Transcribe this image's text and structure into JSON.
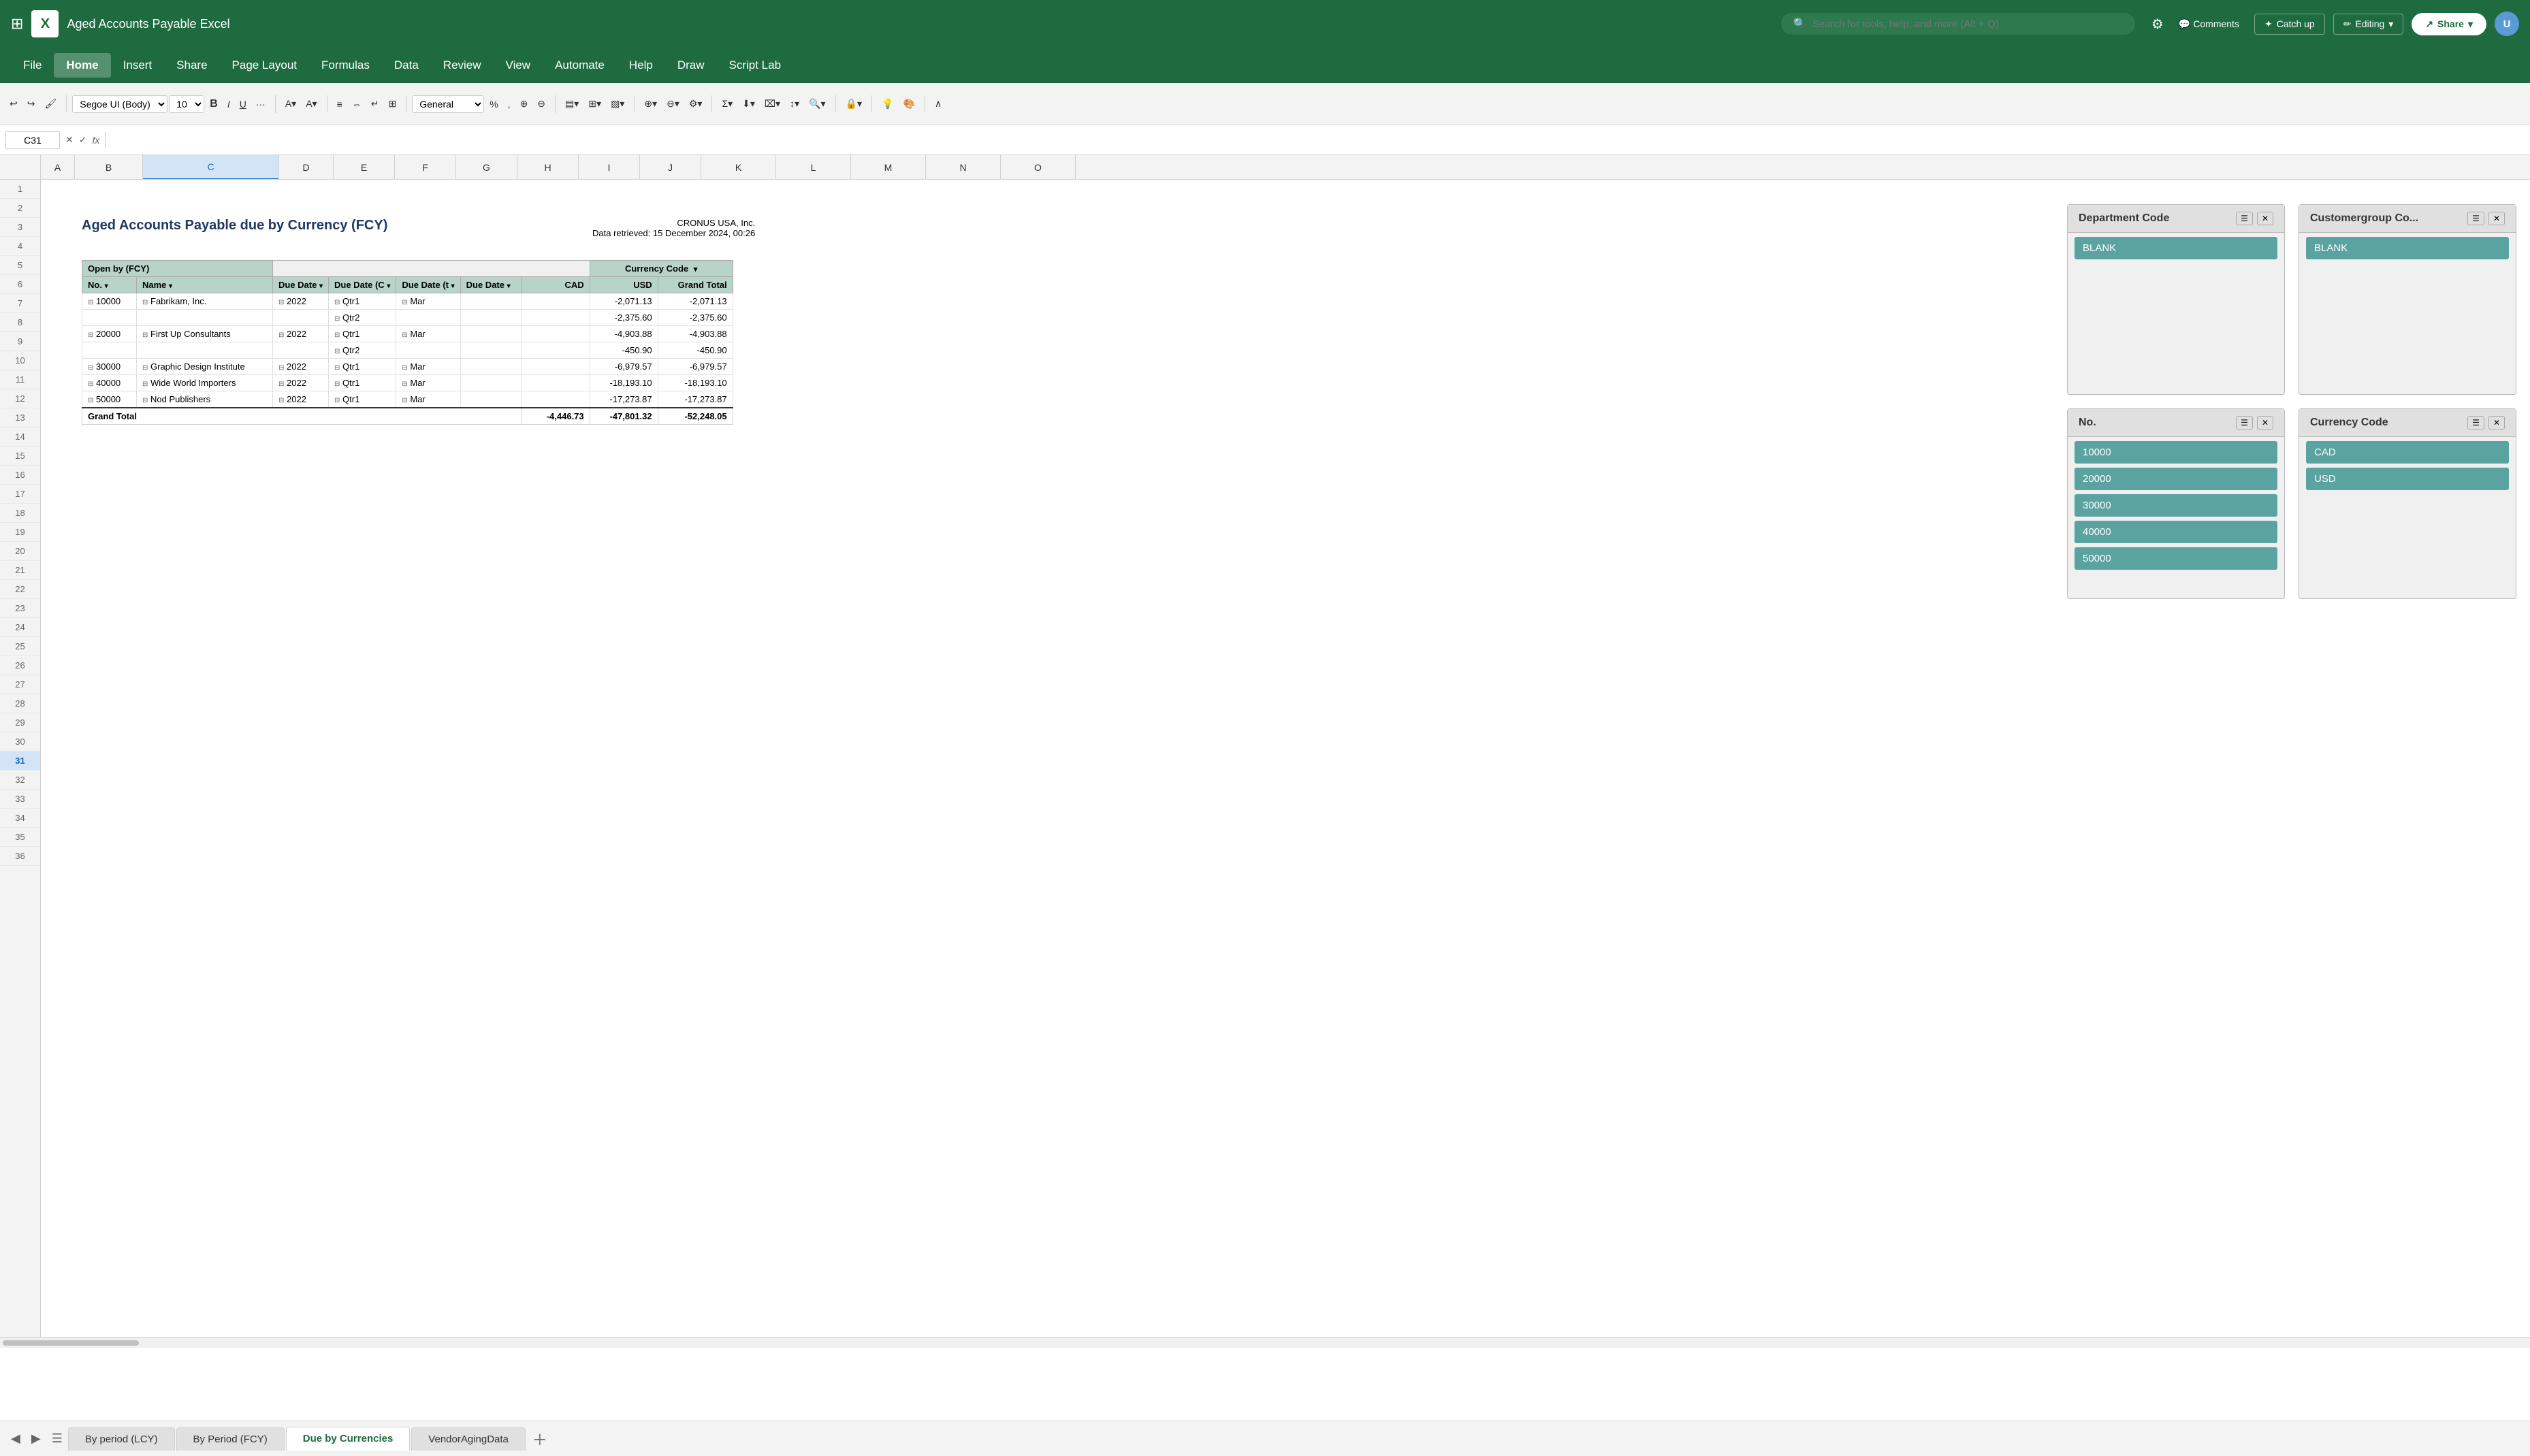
{
  "titlebar": {
    "app_name": "Aged Accounts Payable Excel",
    "search_placeholder": "Search for tools, help, and more (Alt + Q)",
    "catch_up_label": "Catch up",
    "editing_label": "Editing",
    "share_label": "Share"
  },
  "menubar": {
    "items": [
      "File",
      "Home",
      "Insert",
      "Share",
      "Page Layout",
      "Formulas",
      "Data",
      "Review",
      "View",
      "Automate",
      "Help",
      "Draw",
      "Script Lab"
    ]
  },
  "toolbar": {
    "font_family": "Segoe UI (Body)",
    "font_size": "10",
    "format": "General"
  },
  "formulabar": {
    "cell_ref": "C31"
  },
  "spreadsheet": {
    "title": "Aged Accounts Payable due by Currency (FCY)",
    "company": "CRONUS USA, Inc.",
    "retrieved": "Data retrieved: 15 December 2024, 00:26",
    "columns": [
      "",
      "A",
      "B",
      "C",
      "D",
      "E",
      "F",
      "G",
      "H",
      "I",
      "J",
      "K",
      "L",
      "M",
      "N",
      "O"
    ],
    "pivot_headers": {
      "open_by": "Open by (FCY)",
      "currency_code": "Currency Code",
      "no": "No.",
      "name": "Name",
      "due_date": "Due Date",
      "due_date_c": "Due Date (C",
      "due_date_b": "Due Date (t",
      "due_date2": "Due Date",
      "cad": "CAD",
      "usd": "USD",
      "grand_total": "Grand Total"
    },
    "rows": [
      {
        "no": "10000",
        "name": "Fabrikam, Inc.",
        "year": "2022",
        "qtr": "Qtr1",
        "month": "Mar",
        "cad": "",
        "usd": "-2,071.13",
        "grand_total": "-2,071.13"
      },
      {
        "no": "",
        "name": "",
        "year": "",
        "qtr": "Qtr2",
        "month": "",
        "cad": "",
        "usd": "-2,375.60",
        "grand_total": "-2,375.60"
      },
      {
        "no": "20000",
        "name": "First Up Consultants",
        "year": "2022",
        "qtr": "Qtr1",
        "month": "Mar",
        "cad": "",
        "usd": "-4,903.88",
        "grand_total": "-4,903.88"
      },
      {
        "no": "",
        "name": "",
        "year": "",
        "qtr": "Qtr2",
        "month": "",
        "cad": "",
        "usd": "-450.90",
        "grand_total": "-450.90"
      },
      {
        "no": "30000",
        "name": "Graphic Design Institute",
        "year": "2022",
        "qtr": "Qtr1",
        "month": "Mar",
        "cad": "",
        "usd": "-6,979.57",
        "grand_total": "-6,979.57"
      },
      {
        "no": "40000",
        "name": "Wide World Importers",
        "year": "2022",
        "qtr": "Qtr1",
        "month": "Mar",
        "cad": "",
        "usd": "-18,193.10",
        "grand_total": "-18,193.10"
      },
      {
        "no": "50000",
        "name": "Nod Publishers",
        "year": "2022",
        "qtr": "Qtr1",
        "month": "Mar",
        "cad": "",
        "usd": "-17,273.87",
        "grand_total": "-17,273.87"
      },
      {
        "no": "Grand Total",
        "name": "",
        "year": "",
        "qtr": "",
        "month": "",
        "cad": "-4,446.73",
        "usd": "-47,801.32",
        "grand_total": "-52,248.05"
      }
    ]
  },
  "slicers": {
    "department_code": {
      "title": "Department Code",
      "items": [
        "BLANK"
      ]
    },
    "customergroup_code": {
      "title": "Customergroup Co...",
      "items": [
        "BLANK"
      ]
    },
    "no": {
      "title": "No.",
      "items": [
        "10000",
        "20000",
        "30000",
        "40000",
        "50000"
      ]
    },
    "currency_code": {
      "title": "Currency Code",
      "items": [
        "CAD",
        "USD"
      ]
    }
  },
  "tabs": {
    "sheets": [
      "By period (LCY)",
      "By Period (FCY)",
      "Due by Currencies",
      "VendorAgingData"
    ],
    "active": "Due by Currencies"
  },
  "colors": {
    "excel_green": "#1e6b3f",
    "pivot_header_bg": "#b8d4c8",
    "pivot_subheader_bg": "#d9ead3",
    "slicer_item_bg": "#5ba3a0",
    "col_c_bg": "#d3e4f7",
    "active_col_bg": "#d3e4f7"
  }
}
